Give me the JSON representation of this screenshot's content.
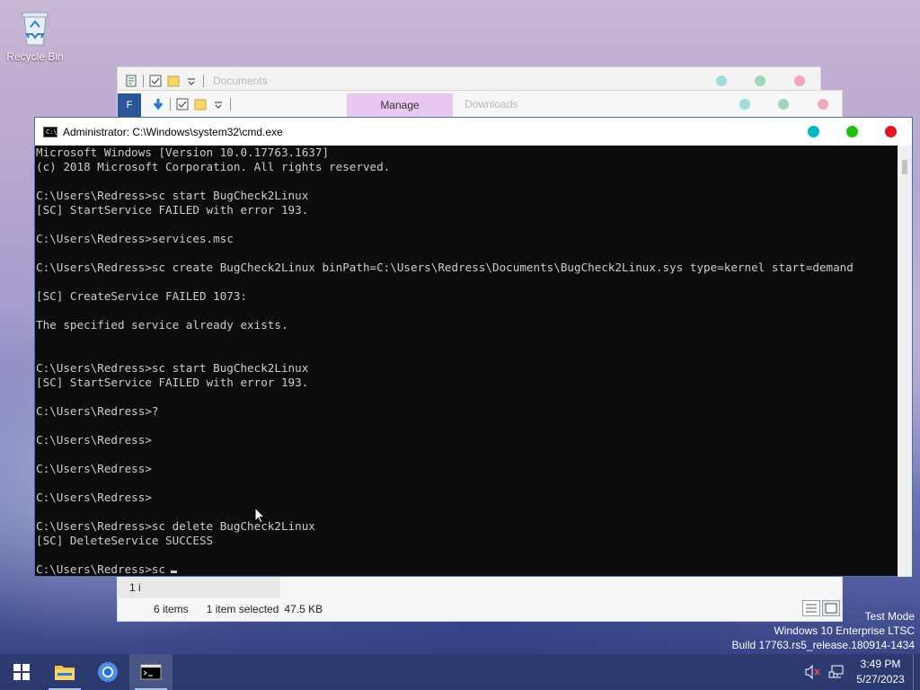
{
  "desktop": {
    "recycle_bin_label": "Recycle Bin"
  },
  "explorer_back": {
    "title": "Documents",
    "buttons": {
      "min_color": "#9fdcdc",
      "max_color": "#9ed8b4",
      "close_color": "#f3a6b6"
    }
  },
  "explorer_front": {
    "file_tab": "F",
    "manage_tab": "Manage",
    "title": "Downloads",
    "status_items": "6 items",
    "status_selected": "1 item selected",
    "status_size": "47.5 KB",
    "status_partial": "1 i"
  },
  "cmd": {
    "title": "Administrator: C:\\Windows\\system32\\cmd.exe",
    "icon_text": "C:\\_",
    "buttons": {
      "min_color": "#00b7c3",
      "max_color": "#16c60c",
      "close_color": "#e81123"
    },
    "lines": [
      "Microsoft Windows [Version 10.0.17763.1637]",
      "(c) 2018 Microsoft Corporation. All rights reserved.",
      "",
      "C:\\Users\\Redress>sc start BugCheck2Linux",
      "[SC] StartService FAILED with error 193.",
      "",
      "C:\\Users\\Redress>services.msc",
      "",
      "C:\\Users\\Redress>sc create BugCheck2Linux binPath=C:\\Users\\Redress\\Documents\\BugCheck2Linux.sys type=kernel start=demand",
      "",
      "[SC] CreateService FAILED 1073:",
      "",
      "The specified service already exists.",
      "",
      "",
      "C:\\Users\\Redress>sc start BugCheck2Linux",
      "[SC] StartService FAILED with error 193.",
      "",
      "C:\\Users\\Redress>?",
      "",
      "C:\\Users\\Redress>",
      "",
      "C:\\Users\\Redress>",
      "",
      "C:\\Users\\Redress>",
      "",
      "C:\\Users\\Redress>sc delete BugCheck2Linux",
      "[SC] DeleteService SUCCESS",
      "",
      "C:\\Users\\Redress>sc"
    ]
  },
  "watermark": {
    "line1": "Test Mode",
    "line2": "Windows 10 Enterprise LTSC",
    "line3": "Build 17763.rs5_release.180914-1434"
  },
  "taskbar": {
    "items": [
      "start-icon",
      "file-explorer-icon",
      "chrome-icon",
      "cmd-icon"
    ],
    "clock_time": "3:49 PM",
    "clock_date": "5/27/2023"
  }
}
